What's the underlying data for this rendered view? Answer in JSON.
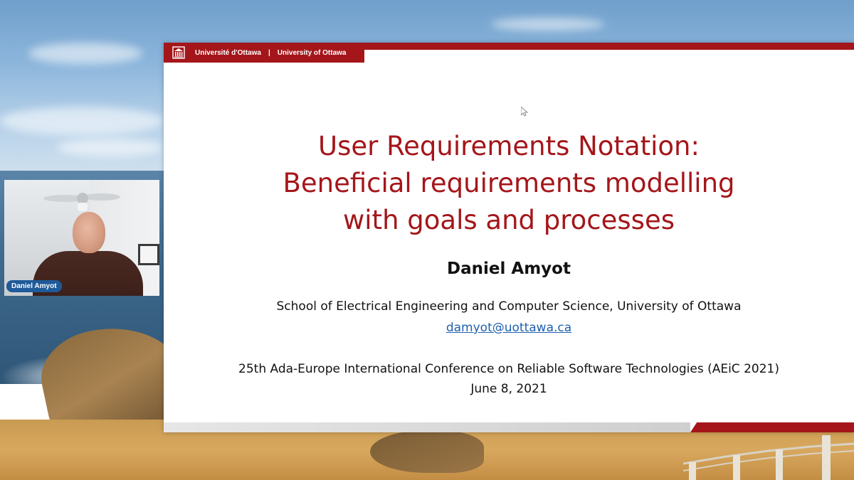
{
  "header": {
    "university_fr": "Université d'Ottawa",
    "separator": "|",
    "university_en": "University of Ottawa",
    "logo_icon": "university-building-icon"
  },
  "slide": {
    "title_lines": [
      "User Requirements Notation:",
      "Beneficial requirements modelling",
      "with goals and processes"
    ],
    "author": "Daniel Amyot",
    "affiliation": "School of Electrical Engineering and Computer Science, University of Ottawa",
    "email": "damyot@uottawa.ca",
    "conference": "25th Ada-Europe International Conference on Reliable Software Technologies (AEiC 2021)",
    "date": "June 8,  2021"
  },
  "participant": {
    "name": "Daniel Amyot"
  },
  "colors": {
    "brand_red": "#a4161a",
    "link_blue": "#1f5fae",
    "name_badge": "#1f5a9a"
  }
}
